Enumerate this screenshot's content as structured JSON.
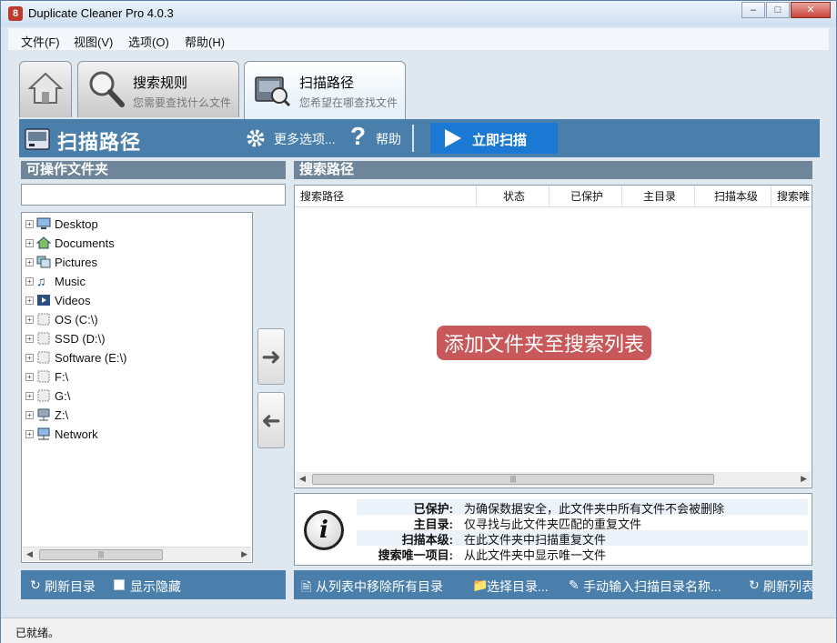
{
  "window": {
    "title": "Duplicate Cleaner Pro 4.0.3",
    "icon": "8"
  },
  "menu": [
    "文件(F)",
    "视图(V)",
    "选项(O)",
    "帮助(H)"
  ],
  "tabs": [
    {
      "label": "",
      "sub": "",
      "icon": "home-icon"
    },
    {
      "label": "搜索规则",
      "sub": "您需要查找什么文件",
      "icon": "magnifier-icon"
    },
    {
      "label": "扫描路径",
      "sub": "您希望在哪查找文件",
      "icon": "scan-path-icon"
    }
  ],
  "header": {
    "title": "扫描路径",
    "more_options": "更多选项...",
    "help": "帮助",
    "scan_now": "立即扫描"
  },
  "left_panel": {
    "title": "可操作文件夹",
    "filter_value": "",
    "tree": [
      {
        "label": "Desktop",
        "icon": "desktop-icon"
      },
      {
        "label": "Documents",
        "icon": "documents-icon"
      },
      {
        "label": "Pictures",
        "icon": "pictures-icon"
      },
      {
        "label": "Music",
        "icon": "music-icon"
      },
      {
        "label": "Videos",
        "icon": "videos-icon"
      },
      {
        "label": "OS (C:\\)",
        "icon": "drive-icon"
      },
      {
        "label": "SSD (D:\\)",
        "icon": "drive-icon"
      },
      {
        "label": "Software (E:\\)",
        "icon": "drive-icon"
      },
      {
        "label": "F:\\",
        "icon": "drive-icon"
      },
      {
        "label": "G:\\",
        "icon": "drive-icon"
      },
      {
        "label": "Z:\\",
        "icon": "network-drive-icon"
      },
      {
        "label": "Network",
        "icon": "network-icon"
      }
    ],
    "footer": {
      "refresh": "刷新目录",
      "show_hidden": "显示隐藏",
      "show_hidden_checked": false
    }
  },
  "right_panel": {
    "title": "搜索路径",
    "columns": [
      "搜索路径",
      "状态",
      "已保护",
      "主目录",
      "扫描本级",
      "搜索唯"
    ],
    "empty_message": "添加文件夹至搜索列表",
    "info": [
      {
        "key": "已保护:",
        "value": "为确保数据安全，此文件夹中所有文件不会被删除"
      },
      {
        "key": "主目录:",
        "value": "仅寻找与此文件夹匹配的重复文件"
      },
      {
        "key": "扫描本级:",
        "value": "在此文件夹中扫描重复文件"
      },
      {
        "key": "搜索唯一项目:",
        "value": "从此文件夹中显示唯一文件"
      }
    ],
    "footer": {
      "remove_all": "从列表中移除所有目录",
      "choose_dir": "选择目录...",
      "manual_input": "手动输入扫描目录名称...",
      "refresh_list": "刷新列表"
    }
  },
  "status": "已就绪。",
  "colors": {
    "header_band": "#4a7fac",
    "scan_button": "#1b78d3",
    "empty_message_bg": "#c9585a",
    "panel_head": "#6f8599"
  }
}
